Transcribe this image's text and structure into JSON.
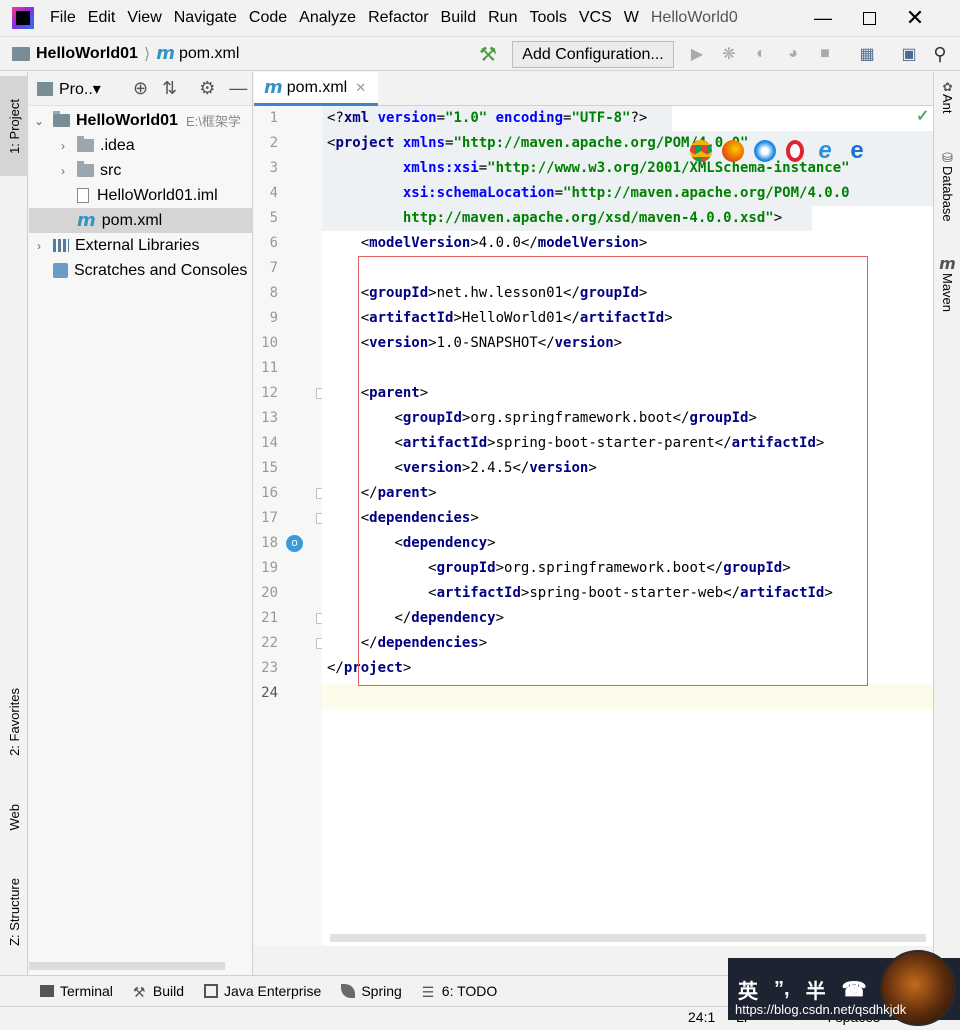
{
  "menubar": {
    "items": [
      "File",
      "Edit",
      "View",
      "Navigate",
      "Code",
      "Analyze",
      "Refactor",
      "Build",
      "Run",
      "Tools",
      "VCS",
      "W"
    ],
    "window_title": "HelloWorld0"
  },
  "navbar": {
    "project": "HelloWorld01",
    "file": "pom.xml",
    "add_configuration": "Add Configuration..."
  },
  "left_stripe": {
    "project": "1: Project",
    "favorites": "2: Favorites",
    "web": "Web",
    "structure": "Z: Structure"
  },
  "right_stripe": {
    "ant": "Ant",
    "database": "Database",
    "maven": "Maven"
  },
  "project_panel": {
    "title": "Pro..▾",
    "tree": [
      {
        "label": "HelloWorld01",
        "suffix": "E:\\框架学",
        "kind": "module",
        "depth": 0,
        "expanded": true
      },
      {
        "label": ".idea",
        "kind": "folder",
        "depth": 1,
        "expanded": false
      },
      {
        "label": "src",
        "kind": "folder",
        "depth": 1,
        "expanded": false
      },
      {
        "label": "HelloWorld01.iml",
        "kind": "iml",
        "depth": 1
      },
      {
        "label": "pom.xml",
        "kind": "maven",
        "depth": 1,
        "selected": true
      },
      {
        "label": "External Libraries",
        "kind": "libs",
        "depth": 0,
        "expanded": false
      },
      {
        "label": "Scratches and Consoles",
        "kind": "scratch",
        "depth": 0
      }
    ]
  },
  "editor": {
    "tab_label": "pom.xml",
    "line_numbers": [
      "1",
      "2",
      "3",
      "4",
      "5",
      "6",
      "7",
      "8",
      "9",
      "10",
      "11",
      "12",
      "13",
      "14",
      "15",
      "16",
      "17",
      "18",
      "19",
      "20",
      "21",
      "22",
      "23",
      "24"
    ],
    "lines": [
      [
        [
          "punct",
          "<?"
        ],
        [
          "tag",
          "xml "
        ],
        [
          "attr",
          "version"
        ],
        [
          "punct",
          "="
        ],
        [
          "str",
          "\"1.0\" "
        ],
        [
          "attr",
          "encoding"
        ],
        [
          "punct",
          "="
        ],
        [
          "str",
          "\"UTF-8\""
        ],
        [
          "punct",
          "?>"
        ]
      ],
      [
        [
          "punct",
          "<"
        ],
        [
          "tag",
          "project "
        ],
        [
          "attr",
          "xmlns"
        ],
        [
          "punct",
          "="
        ],
        [
          "str",
          "\"http://maven.apache.org/POM/4.0.0\""
        ]
      ],
      [
        [
          "txt",
          "         "
        ],
        [
          "attr",
          "xmlns:xsi"
        ],
        [
          "punct",
          "="
        ],
        [
          "str",
          "\"http://www.w3.org/2001/XMLSchema-instance\""
        ]
      ],
      [
        [
          "txt",
          "         "
        ],
        [
          "attr",
          "xsi:schemaLocation"
        ],
        [
          "punct",
          "="
        ],
        [
          "str",
          "\"http://maven.apache.org/POM/4.0.0"
        ]
      ],
      [
        [
          "txt",
          "         "
        ],
        [
          "str",
          "http://maven.apache.org/xsd/maven-4.0.0.xsd\""
        ],
        [
          "punct",
          ">"
        ]
      ],
      [
        [
          "txt",
          "    "
        ],
        [
          "punct",
          "<"
        ],
        [
          "tag",
          "modelVersion"
        ],
        [
          "punct",
          ">"
        ],
        [
          "txt",
          "4.0.0"
        ],
        [
          "punct",
          "</"
        ],
        [
          "tag",
          "modelVersion"
        ],
        [
          "punct",
          ">"
        ]
      ],
      [],
      [
        [
          "txt",
          "    "
        ],
        [
          "punct",
          "<"
        ],
        [
          "tag",
          "groupId"
        ],
        [
          "punct",
          ">"
        ],
        [
          "txt",
          "net.hw.lesson01"
        ],
        [
          "punct",
          "</"
        ],
        [
          "tag",
          "groupId"
        ],
        [
          "punct",
          ">"
        ]
      ],
      [
        [
          "txt",
          "    "
        ],
        [
          "punct",
          "<"
        ],
        [
          "tag",
          "artifactId"
        ],
        [
          "punct",
          ">"
        ],
        [
          "txt",
          "HelloWorld01"
        ],
        [
          "punct",
          "</"
        ],
        [
          "tag",
          "artifactId"
        ],
        [
          "punct",
          ">"
        ]
      ],
      [
        [
          "txt",
          "    "
        ],
        [
          "punct",
          "<"
        ],
        [
          "tag",
          "version"
        ],
        [
          "punct",
          ">"
        ],
        [
          "txt",
          "1.0-SNAPSHOT"
        ],
        [
          "punct",
          "</"
        ],
        [
          "tag",
          "version"
        ],
        [
          "punct",
          ">"
        ]
      ],
      [],
      [
        [
          "txt",
          "    "
        ],
        [
          "punct",
          "<"
        ],
        [
          "tag",
          "parent"
        ],
        [
          "punct",
          ">"
        ]
      ],
      [
        [
          "txt",
          "        "
        ],
        [
          "punct",
          "<"
        ],
        [
          "tag",
          "groupId"
        ],
        [
          "punct",
          ">"
        ],
        [
          "txt",
          "org.springframework.boot"
        ],
        [
          "punct",
          "</"
        ],
        [
          "tag",
          "groupId"
        ],
        [
          "punct",
          ">"
        ]
      ],
      [
        [
          "txt",
          "        "
        ],
        [
          "punct",
          "<"
        ],
        [
          "tag",
          "artifactId"
        ],
        [
          "punct",
          ">"
        ],
        [
          "txt",
          "spring-boot-starter-parent"
        ],
        [
          "punct",
          "</"
        ],
        [
          "tag",
          "artifactId"
        ],
        [
          "punct",
          ">"
        ]
      ],
      [
        [
          "txt",
          "        "
        ],
        [
          "punct",
          "<"
        ],
        [
          "tag",
          "version"
        ],
        [
          "punct",
          ">"
        ],
        [
          "txt",
          "2.4.5"
        ],
        [
          "punct",
          "</"
        ],
        [
          "tag",
          "version"
        ],
        [
          "punct",
          ">"
        ]
      ],
      [
        [
          "txt",
          "    "
        ],
        [
          "punct",
          "</"
        ],
        [
          "tag",
          "parent"
        ],
        [
          "punct",
          ">"
        ]
      ],
      [
        [
          "txt",
          "    "
        ],
        [
          "punct",
          "<"
        ],
        [
          "tag",
          "dependencies"
        ],
        [
          "punct",
          ">"
        ]
      ],
      [
        [
          "txt",
          "        "
        ],
        [
          "punct",
          "<"
        ],
        [
          "tag",
          "dependency"
        ],
        [
          "punct",
          ">"
        ]
      ],
      [
        [
          "txt",
          "            "
        ],
        [
          "punct",
          "<"
        ],
        [
          "tag",
          "groupId"
        ],
        [
          "punct",
          ">"
        ],
        [
          "txt",
          "org.springframework.boot"
        ],
        [
          "punct",
          "</"
        ],
        [
          "tag",
          "groupId"
        ],
        [
          "punct",
          ">"
        ]
      ],
      [
        [
          "txt",
          "            "
        ],
        [
          "punct",
          "<"
        ],
        [
          "tag",
          "artifactId"
        ],
        [
          "punct",
          ">"
        ],
        [
          "txt",
          "spring-boot-starter-web"
        ],
        [
          "punct",
          "</"
        ],
        [
          "tag",
          "artifactId"
        ],
        [
          "punct",
          ">"
        ]
      ],
      [
        [
          "txt",
          "        "
        ],
        [
          "punct",
          "</"
        ],
        [
          "tag",
          "dependency"
        ],
        [
          "punct",
          ">"
        ]
      ],
      [
        [
          "txt",
          "    "
        ],
        [
          "punct",
          "</"
        ],
        [
          "tag",
          "dependencies"
        ],
        [
          "punct",
          ">"
        ]
      ],
      [
        [
          "punct",
          "</"
        ],
        [
          "tag",
          "project"
        ],
        [
          "punct",
          ">"
        ]
      ],
      []
    ],
    "current_line": 24
  },
  "bottom_tabs": [
    "Terminal",
    "Build",
    "Java Enterprise",
    "Spring",
    "6: TODO"
  ],
  "statusbar": {
    "position": "24:1",
    "line_sep": "LF",
    "indent": "4 spaces"
  },
  "overlay": {
    "ime_labels": [
      "英",
      "”,",
      "半",
      "☎"
    ],
    "watermark": "https://blog.csdn.net/qsdhkjdk"
  },
  "colors": {
    "tag": "#000080",
    "attribute": "#0000ff",
    "string": "#008000",
    "annotation_box": "#e06060",
    "tab_underline": "#4083c9"
  }
}
